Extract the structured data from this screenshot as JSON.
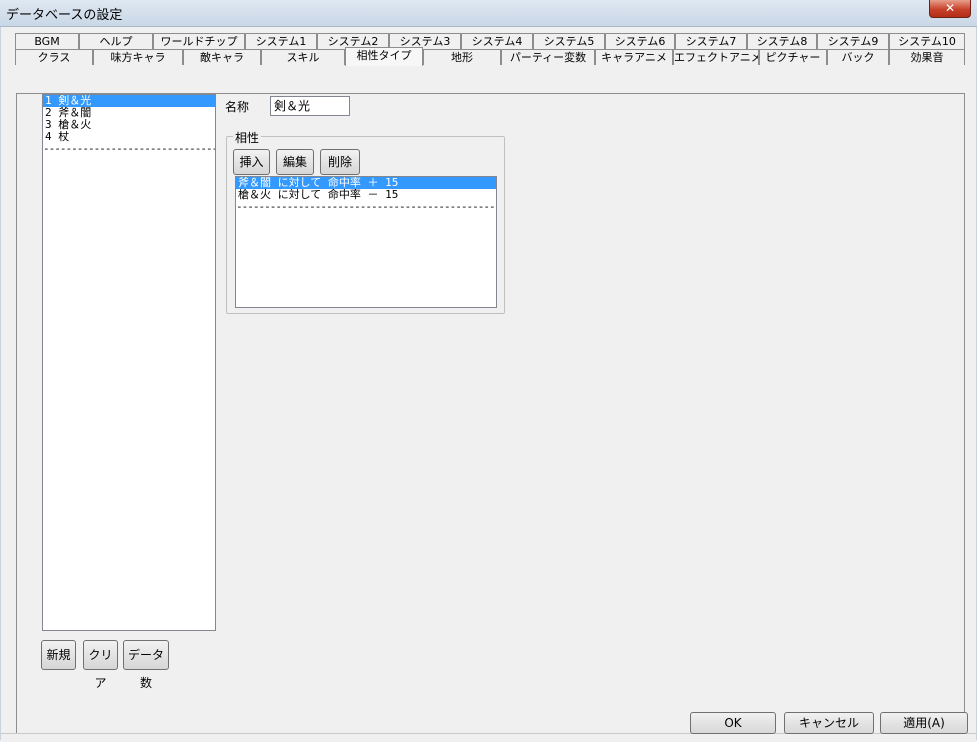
{
  "window": {
    "title": "データベースの設定",
    "close_glyph": "✕"
  },
  "tabs": {
    "row1": [
      "BGM",
      "ヘルプ",
      "ワールドチップ",
      "システム1",
      "システム2",
      "システム3",
      "システム4",
      "システム5",
      "システム6",
      "システム7",
      "システム8",
      "システム9",
      "システム10"
    ],
    "row2": [
      "クラス",
      "味方キャラ",
      "敵キャラ",
      "スキル",
      "相性タイプ",
      "地形",
      "パーティー変数",
      "キャラアニメ",
      "エフェクトアニメ",
      "ピクチャー",
      "バック",
      "効果音"
    ],
    "active": "相性タイプ"
  },
  "left_list": {
    "items": [
      "1 剣＆光",
      "2 斧＆闇",
      "3 槍＆火",
      "4 杖"
    ],
    "selected_index": 0,
    "separator": "-----------------------------------------"
  },
  "left_buttons": {
    "new": "新規",
    "clear": "クリア",
    "count": "データ数"
  },
  "name_field": {
    "label": "名称",
    "value": "剣＆光"
  },
  "affinity_group": {
    "title": "相性",
    "buttons": {
      "insert": "挿入",
      "edit": "編集",
      "delete": "削除"
    },
    "items": [
      "斧＆闇 に対して 命中率 ＋ 15",
      "槍＆火 に対して 命中率 － 15"
    ],
    "selected_index": 0,
    "separator": "---------------------------------------------------------"
  },
  "dialog_buttons": {
    "ok": "OK",
    "cancel": "キャンセル",
    "apply": "適用(A)"
  }
}
